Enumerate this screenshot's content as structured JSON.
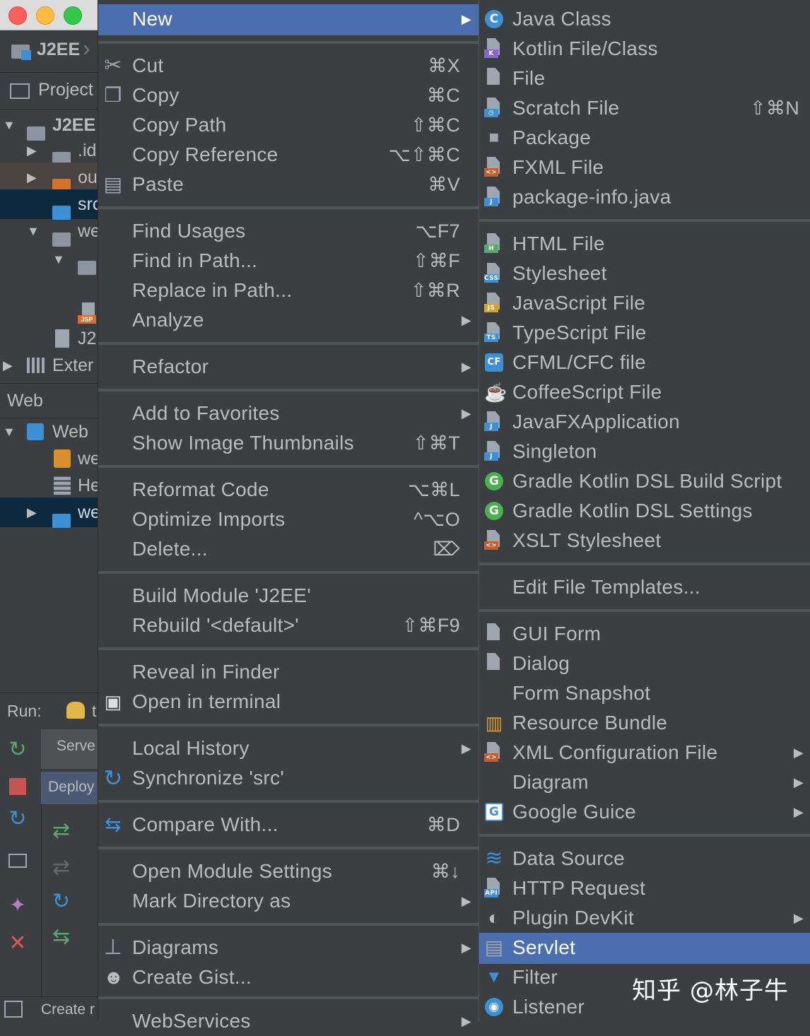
{
  "ide": {
    "project_name": "J2EE",
    "project_tab": "Project",
    "tree": {
      "root": "J2EE",
      "idea_folder": ".id",
      "out_folder": "ou",
      "src_folder": "src",
      "web_folder": "we",
      "iml_file": "J2",
      "external_libs": "Exter"
    },
    "web_tool_label": "Web",
    "web_tree": {
      "root": "Web",
      "web_xml": "we",
      "hello_servlet": "He",
      "web_folder": "we"
    },
    "run_label": "Run:",
    "run_tab": "t",
    "servers_label": "Serve",
    "deploy_label": "Deploy",
    "status_text": "Create r"
  },
  "menu1": {
    "items": [
      {
        "label": "New",
        "shortcut": "",
        "arrow": true,
        "icon": ""
      },
      {
        "label": "Cut",
        "shortcut": "⌘X",
        "arrow": false,
        "icon": "scissors-icon"
      },
      {
        "label": "Copy",
        "shortcut": "⌘C",
        "arrow": false,
        "icon": "copy-icon"
      },
      {
        "label": "Copy Path",
        "shortcut": "⇧⌘C",
        "arrow": false,
        "icon": ""
      },
      {
        "label": "Copy Reference",
        "shortcut": "⌥⇧⌘C",
        "arrow": false,
        "icon": ""
      },
      {
        "label": "Paste",
        "shortcut": "⌘V",
        "arrow": false,
        "icon": "paste-icon"
      },
      {
        "label": "Find Usages",
        "shortcut": "⌥F7",
        "arrow": false,
        "icon": ""
      },
      {
        "label": "Find in Path...",
        "shortcut": "⇧⌘F",
        "arrow": false,
        "icon": ""
      },
      {
        "label": "Replace in Path...",
        "shortcut": "⇧⌘R",
        "arrow": false,
        "icon": ""
      },
      {
        "label": "Analyze",
        "shortcut": "",
        "arrow": true,
        "icon": ""
      },
      {
        "label": "Refactor",
        "shortcut": "",
        "arrow": true,
        "icon": ""
      },
      {
        "label": "Add to Favorites",
        "shortcut": "",
        "arrow": true,
        "icon": ""
      },
      {
        "label": "Show Image Thumbnails",
        "shortcut": "⇧⌘T",
        "arrow": false,
        "icon": ""
      },
      {
        "label": "Reformat Code",
        "shortcut": "⌥⌘L",
        "arrow": false,
        "icon": ""
      },
      {
        "label": "Optimize Imports",
        "shortcut": "^⌥O",
        "arrow": false,
        "icon": ""
      },
      {
        "label": "Delete...",
        "shortcut": "⌦",
        "arrow": false,
        "icon": ""
      },
      {
        "label": "Build Module 'J2EE'",
        "shortcut": "",
        "arrow": false,
        "icon": ""
      },
      {
        "label": "Rebuild '<default>'",
        "shortcut": "⇧⌘F9",
        "arrow": false,
        "icon": ""
      },
      {
        "label": "Reveal in Finder",
        "shortcut": "",
        "arrow": false,
        "icon": ""
      },
      {
        "label": "Open in terminal",
        "shortcut": "",
        "arrow": false,
        "icon": "terminal-icon"
      },
      {
        "label": "Local History",
        "shortcut": "",
        "arrow": true,
        "icon": ""
      },
      {
        "label": "Synchronize 'src'",
        "shortcut": "",
        "arrow": false,
        "icon": "sync-icon"
      },
      {
        "label": "Compare With...",
        "shortcut": "⌘D",
        "arrow": false,
        "icon": "compare-icon"
      },
      {
        "label": "Open Module Settings",
        "shortcut": "⌘↓",
        "arrow": false,
        "icon": ""
      },
      {
        "label": "Mark Directory as",
        "shortcut": "",
        "arrow": true,
        "icon": ""
      },
      {
        "label": "Diagrams",
        "shortcut": "",
        "arrow": true,
        "icon": "diagram-icon"
      },
      {
        "label": "Create Gist...",
        "shortcut": "",
        "arrow": false,
        "icon": "github-icon"
      },
      {
        "label": "WebServices",
        "shortcut": "",
        "arrow": true,
        "icon": ""
      }
    ]
  },
  "menu2": {
    "items": [
      {
        "label": "Java Class",
        "shortcut": "",
        "arrow": false,
        "icon": "java-class-icon"
      },
      {
        "label": "Kotlin File/Class",
        "shortcut": "",
        "arrow": false,
        "icon": "kotlin-file-icon"
      },
      {
        "label": "File",
        "shortcut": "",
        "arrow": false,
        "icon": "file-icon"
      },
      {
        "label": "Scratch File",
        "shortcut": "⇧⌘N",
        "arrow": false,
        "icon": "scratch-file-icon"
      },
      {
        "label": "Package",
        "shortcut": "",
        "arrow": false,
        "icon": "package-icon"
      },
      {
        "label": "FXML File",
        "shortcut": "",
        "arrow": false,
        "icon": "fxml-file-icon"
      },
      {
        "label": "package-info.java",
        "shortcut": "",
        "arrow": false,
        "icon": "java-file-icon"
      },
      {
        "label": "HTML File",
        "shortcut": "",
        "arrow": false,
        "icon": "html-file-icon"
      },
      {
        "label": "Stylesheet",
        "shortcut": "",
        "arrow": false,
        "icon": "css-file-icon"
      },
      {
        "label": "JavaScript File",
        "shortcut": "",
        "arrow": false,
        "icon": "js-file-icon"
      },
      {
        "label": "TypeScript File",
        "shortcut": "",
        "arrow": false,
        "icon": "ts-file-icon"
      },
      {
        "label": "CFML/CFC file",
        "shortcut": "",
        "arrow": false,
        "icon": "cfml-file-icon"
      },
      {
        "label": "CoffeeScript File",
        "shortcut": "",
        "arrow": false,
        "icon": "coffeescript-file-icon"
      },
      {
        "label": "JavaFXApplication",
        "shortcut": "",
        "arrow": false,
        "icon": "javafx-file-icon"
      },
      {
        "label": "Singleton",
        "shortcut": "",
        "arrow": false,
        "icon": "java-file-icon"
      },
      {
        "label": "Gradle Kotlin DSL Build Script",
        "shortcut": "",
        "arrow": false,
        "icon": "gradle-icon"
      },
      {
        "label": "Gradle Kotlin DSL Settings",
        "shortcut": "",
        "arrow": false,
        "icon": "gradle-icon"
      },
      {
        "label": "XSLT Stylesheet",
        "shortcut": "",
        "arrow": false,
        "icon": "xslt-file-icon"
      },
      {
        "label": "Edit File Templates...",
        "shortcut": "",
        "arrow": false,
        "icon": ""
      },
      {
        "label": "GUI Form",
        "shortcut": "",
        "arrow": false,
        "icon": "gui-form-icon"
      },
      {
        "label": "Dialog",
        "shortcut": "",
        "arrow": false,
        "icon": "dialog-icon"
      },
      {
        "label": "Form Snapshot",
        "shortcut": "",
        "arrow": false,
        "icon": ""
      },
      {
        "label": "Resource Bundle",
        "shortcut": "",
        "arrow": false,
        "icon": "resource-bundle-icon"
      },
      {
        "label": "XML Configuration File",
        "shortcut": "",
        "arrow": true,
        "icon": "xml-file-icon"
      },
      {
        "label": "Diagram",
        "shortcut": "",
        "arrow": true,
        "icon": ""
      },
      {
        "label": "Google Guice",
        "shortcut": "",
        "arrow": true,
        "icon": "google-guice-icon"
      },
      {
        "label": "Data Source",
        "shortcut": "",
        "arrow": false,
        "icon": "database-icon"
      },
      {
        "label": "HTTP Request",
        "shortcut": "",
        "arrow": false,
        "icon": "api-file-icon"
      },
      {
        "label": "Plugin DevKit",
        "shortcut": "",
        "arrow": true,
        "icon": "plugin-icon"
      },
      {
        "label": "Servlet",
        "shortcut": "",
        "arrow": false,
        "icon": "servlet-icon"
      },
      {
        "label": "Filter",
        "shortcut": "",
        "arrow": false,
        "icon": "filter-icon"
      },
      {
        "label": "Listener",
        "shortcut": "",
        "arrow": false,
        "icon": "listener-icon"
      }
    ]
  },
  "watermark": "知乎 @林子牛",
  "colors": {
    "selection": "#4b6eaf",
    "menu_bg": "#3c3f41",
    "text": "#bbbbbb"
  }
}
